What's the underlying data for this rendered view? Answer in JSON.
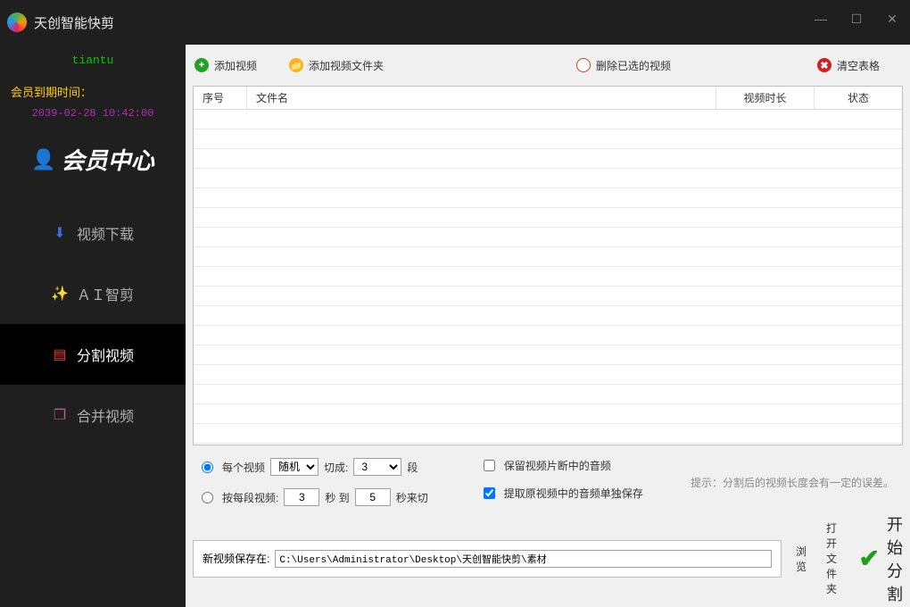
{
  "app": {
    "title": "天创智能快剪"
  },
  "window_controls": {
    "min": "—",
    "max": "☐",
    "close": "✕"
  },
  "sidebar": {
    "username": "tiantu",
    "expire_label": "会员到期时间：",
    "expire_time": "2039-02-28 10:42:00",
    "member_center": "会员中心",
    "items": [
      {
        "label": "视频下载",
        "icon": "⬇",
        "color": "#3b6bdc"
      },
      {
        "label": "ＡＩ智剪",
        "icon": "✨",
        "color": "#c7a02a"
      },
      {
        "label": "分割视频",
        "icon": "▤",
        "color": "#e03a2a"
      },
      {
        "label": "合并视频",
        "icon": "❐",
        "color": "#c05a8a"
      }
    ]
  },
  "toolbar": {
    "add_video": "添加视频",
    "add_folder": "添加视频文件夹",
    "delete_selected": "删除已选的视频",
    "clear_table": "清空表格"
  },
  "columns": {
    "index": "序号",
    "filename": "文件名",
    "duration": "视频时长",
    "status": "状态"
  },
  "options": {
    "per_video_label": "每个视频",
    "random_value": "随机",
    "cut_into": "切成:",
    "seg_count": "3",
    "seg_unit": "段",
    "per_segment_label": "按每段视频:",
    "sec_a": "3",
    "sec_between": "秒 到",
    "sec_b": "5",
    "sec_cut": "秒来切",
    "keep_audio": "保留视频片断中的音频",
    "extract_audio": "提取原视频中的音频单独保存",
    "hint": "提示：分割后的视频长度会有一定的误差。"
  },
  "save": {
    "label": "新视频保存在:",
    "path": "C:\\Users\\Administrator\\Desktop\\天创智能快剪\\素材",
    "browse": "浏览",
    "open_folder": "打开文件夹",
    "start": "开始分割"
  }
}
